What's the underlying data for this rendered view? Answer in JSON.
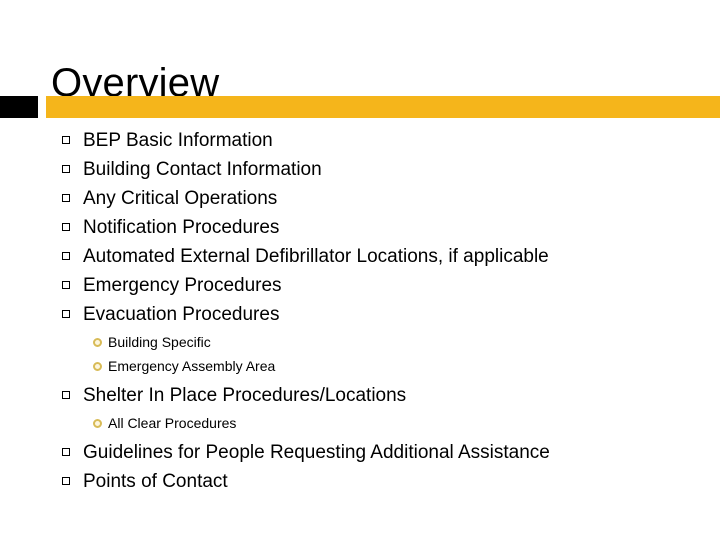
{
  "slide": {
    "title": "Overview",
    "accent_color": "#f5b51b",
    "accent_dark_color": "#000000",
    "text_color": "#000000",
    "sub_bullet_color": "#d8bb57",
    "background_color": "#ffffff"
  },
  "markers": {
    "level1": "hollow-square-bullet",
    "level2": "gold-ring-bullet"
  },
  "outline": [
    {
      "level": 1,
      "text": "BEP Basic Information"
    },
    {
      "level": 1,
      "text": "Building Contact Information"
    },
    {
      "level": 1,
      "text": "Any Critical Operations"
    },
    {
      "level": 1,
      "text": "Notification Procedures"
    },
    {
      "level": 1,
      "text": "Automated External Defibrillator Locations, if applicable"
    },
    {
      "level": 1,
      "text": "Emergency Procedures"
    },
    {
      "level": 1,
      "text": "Evacuation Procedures"
    },
    {
      "level": 2,
      "text": "Building Specific"
    },
    {
      "level": 2,
      "text": "Emergency Assembly Area"
    },
    {
      "level": 1,
      "text": "Shelter In Place Procedures/Locations"
    },
    {
      "level": 2,
      "text": "All Clear Procedures"
    },
    {
      "level": 1,
      "text": "Guidelines for People Requesting Additional Assistance"
    },
    {
      "level": 1,
      "text": "Points of Contact"
    }
  ]
}
